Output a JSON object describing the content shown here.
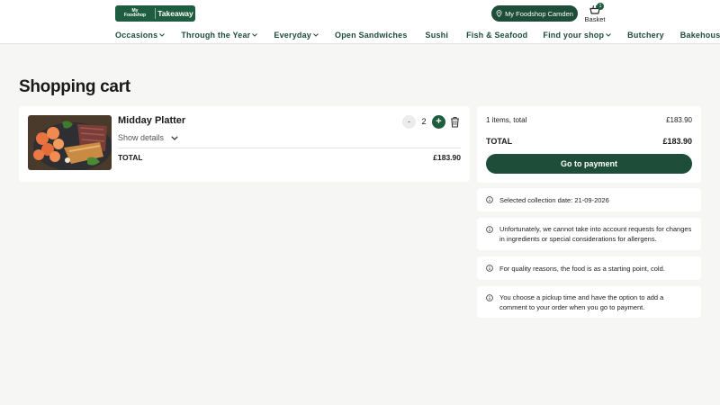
{
  "header": {
    "logo": {
      "brand_line1": "My",
      "brand_line2": "Foodshop",
      "suffix": "Takeaway"
    },
    "store_button": "My Foodshop Camden",
    "basket": {
      "label": "Basket",
      "count": "1"
    },
    "nav": [
      {
        "label": "Occasions",
        "dropdown": true
      },
      {
        "label": "Through the Year",
        "dropdown": true
      },
      {
        "label": "Everyday",
        "dropdown": true
      },
      {
        "label": "Open Sandwiches",
        "dropdown": false
      },
      {
        "label": "Sushi",
        "dropdown": false
      },
      {
        "label": "Fish & Seafood",
        "dropdown": false
      },
      {
        "label": "Find your shop",
        "dropdown": true
      },
      {
        "label": "Butchery",
        "dropdown": false
      },
      {
        "label": "Bakehouse",
        "dropdown": false
      }
    ]
  },
  "page_title": "Shopping cart",
  "cart": {
    "item": {
      "name": "Midday Platter",
      "details_label": "Show details",
      "quantity": "2",
      "minus": "-",
      "plus": "+",
      "total_label": "TOTAL",
      "total_value": "£183.90"
    }
  },
  "summary": {
    "items_label": "1 items, total",
    "items_value": "£183.90",
    "total_label": "TOTAL",
    "total_value": "£183.90",
    "pay_button": "Go to payment"
  },
  "info": [
    "Selected collection date: 21-09-2026",
    "Unfortunately, we cannot take into account requests for changes in ingredients or special considerations for allergens.",
    "For quality reasons, the food is as a starting point, cold.",
    "You choose a pickup time and have the option to add a comment to your order when you go to payment."
  ],
  "colors": {
    "brand": "#1e5d40",
    "brand_dark": "#1e4d3a",
    "background": "#f6f6f4"
  }
}
